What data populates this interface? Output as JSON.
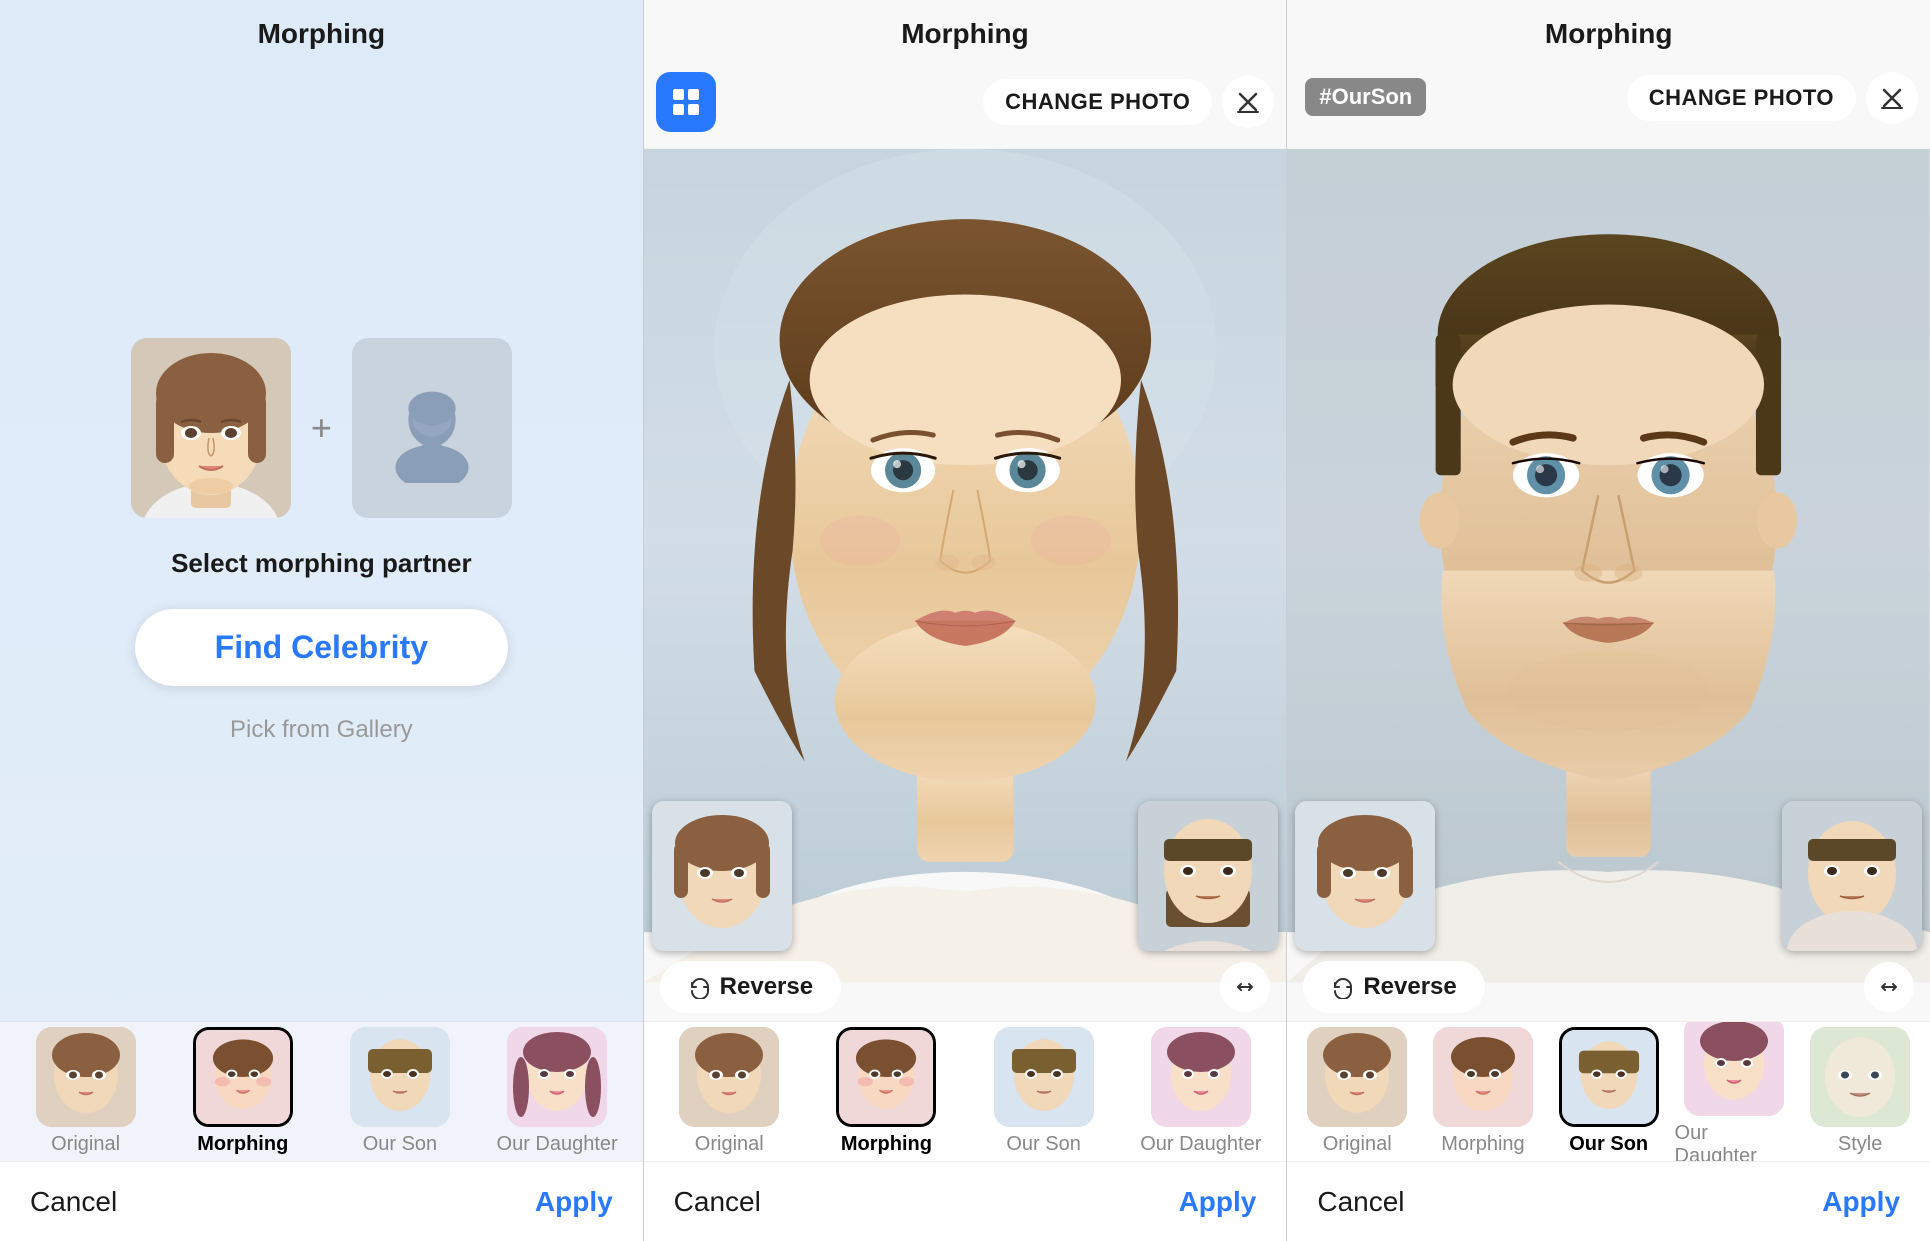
{
  "panel1": {
    "title": "Morphing",
    "select_label": "Select morphing partner",
    "find_celebrity_label": "Find Celebrity",
    "pick_gallery_label": "Pick from Gallery",
    "footer": {
      "cancel": "Cancel",
      "apply": "Apply"
    },
    "toolbar": [
      {
        "label": "Original",
        "bold": false
      },
      {
        "label": "Morphing",
        "bold": true
      },
      {
        "label": "Our Son",
        "bold": false
      },
      {
        "label": "Our Daughter",
        "bold": false
      }
    ]
  },
  "panel2": {
    "title": "Morphing",
    "change_photo_label": "CHANGE PHOTO",
    "reverse_label": "Reverse",
    "footer": {
      "cancel": "Cancel",
      "apply": "Apply"
    },
    "toolbar": [
      {
        "label": "Original",
        "bold": false
      },
      {
        "label": "Morphing",
        "bold": true
      },
      {
        "label": "Our Son",
        "bold": false
      },
      {
        "label": "Our Daughter",
        "bold": false
      }
    ]
  },
  "panel3": {
    "title": "Morphing",
    "change_photo_label": "CHANGE PHOTO",
    "hashtag": "#OurSon",
    "reverse_label": "Reverse",
    "footer": {
      "cancel": "Cancel",
      "apply": "Apply"
    },
    "toolbar": [
      {
        "label": "Original",
        "bold": false
      },
      {
        "label": "Morphing",
        "bold": false
      },
      {
        "label": "Our Son",
        "bold": true
      },
      {
        "label": "Our Daughter",
        "bold": false
      },
      {
        "label": "Style",
        "bold": false
      }
    ]
  },
  "icons": {
    "grid": "⊞",
    "eraser": "◇",
    "reverse": "↺",
    "expand": "⟺"
  }
}
